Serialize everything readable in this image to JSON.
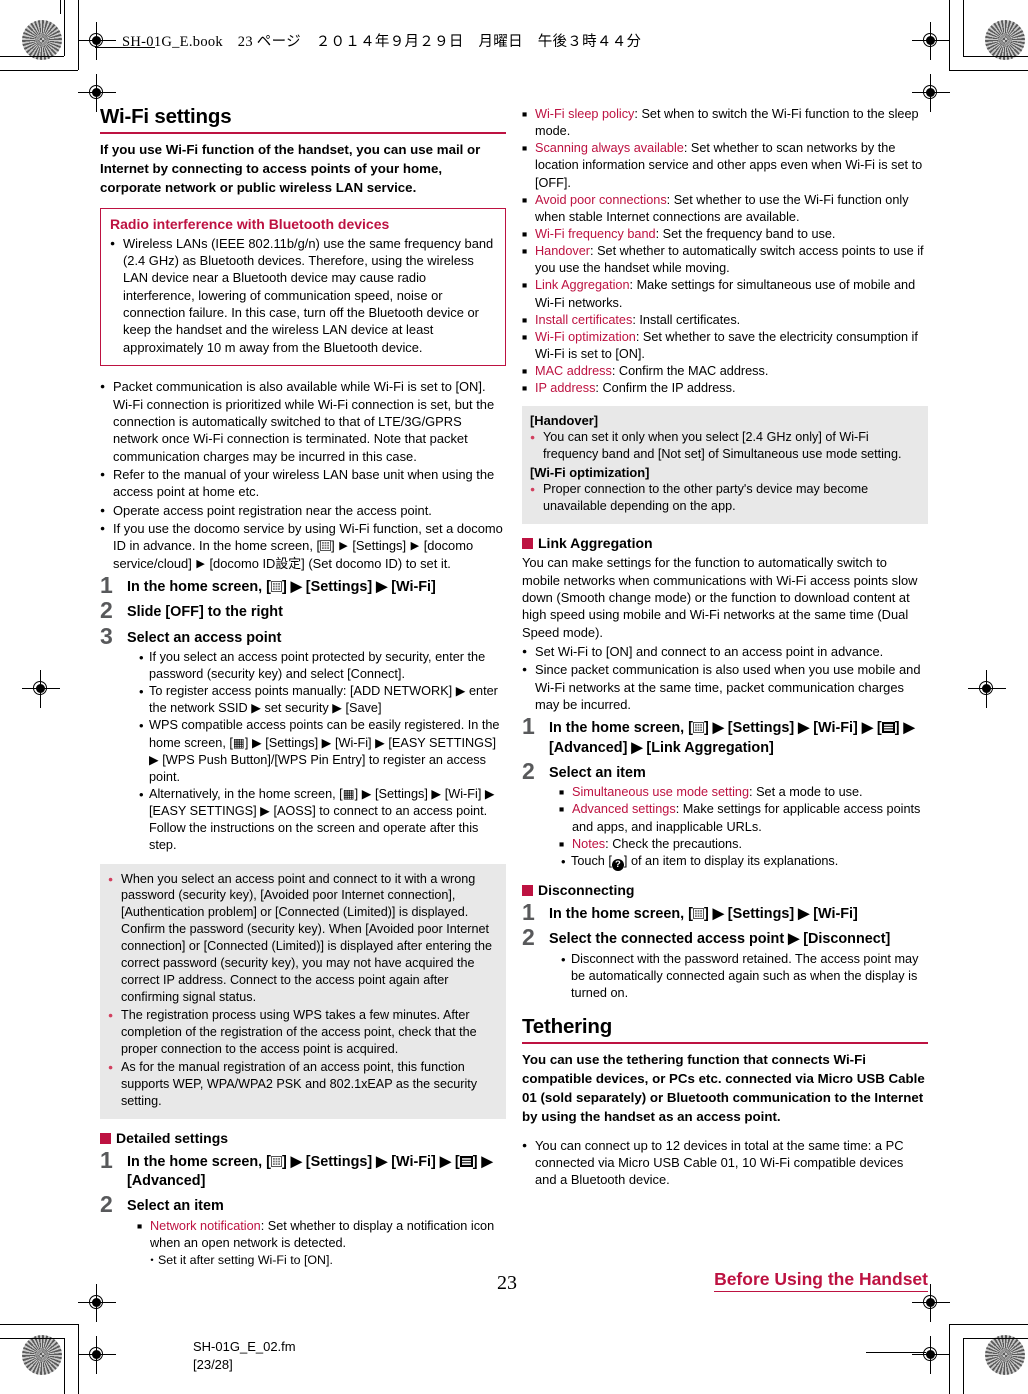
{
  "header": {
    "file_line": "SH-01G_E.book　23 ページ　２０１４年９月２９日　月曜日　午後３時４４分"
  },
  "footer": {
    "page_number": "23",
    "chapter": "Before Using the Handset",
    "file_name": "SH-01G_E_02.fm",
    "file_pages": "[23/28]"
  },
  "colors": {
    "accent": "#bd1241",
    "note_bg": "#e8e8e8",
    "step_num": "#58595b"
  },
  "left_column": {
    "section_title": "Wi-Fi settings",
    "lead": "If you use Wi-Fi function of the handset, you can use mail or Internet by connecting to access points of your home, corporate network or public wireless LAN service.",
    "red_box": {
      "title": "Radio interference with Bluetooth devices",
      "bullets": [
        "Wireless LANs (IEEE 802.11b/g/n) use the same frequency band (2.4 GHz) as Bluetooth devices. Therefore, using the wireless LAN device near a Bluetooth device may cause radio interference, lowering of communication speed, noise or connection failure. In this case, turn off the Bluetooth device or keep the handset and the wireless LAN device at least approximately 10 m away from the Bluetooth device."
      ]
    },
    "notes": [
      "Packet communication is also available while Wi-Fi is set to [ON]. Wi-Fi connection is prioritized while Wi-Fi connection is set, but the connection is automatically switched to that of LTE/3G/GPRS network once Wi-Fi connection is terminated. Note that packet communication charges may be incurred in this case.",
      "Refer to the manual of your wireless LAN base unit when using the access point at home etc.",
      "Operate access point registration near the access point."
    ],
    "note_docomo": {
      "part1": "If you use the docomo service by using Wi-Fi function, set a docomo ID in advance. In the home screen, [",
      "part2": "] ",
      "part3": " [Settings] ",
      "part4": " [docomo service/cloud] ",
      "part5": " [docomo ID設定] (Set docomo ID) to set it."
    },
    "steps": [
      {
        "num": "1",
        "title_pre": "In the home screen, [",
        "title_post": "] ▶ [Settings] ▶ [Wi-Fi]"
      },
      {
        "num": "2",
        "title": "Slide [OFF] to the right"
      },
      {
        "num": "3",
        "title": "Select an access point",
        "bullets": [
          "If you select an access point protected by security, enter the password (security key) and select [Connect].",
          "To register access points manually: [ADD NETWORK] ▶ enter the network SSID ▶ set security ▶ [Save]",
          "WPS compatible access points can be easily registered. In the home screen, [▦] ▶ [Settings] ▶ [Wi-Fi] ▶ [EASY SETTINGS] ▶ [WPS Push Button]/[WPS Pin Entry] to register an access point.",
          "Alternatively, in the home screen, [▦] ▶ [Settings] ▶ [Wi-Fi] ▶ [EASY SETTINGS] ▶ [AOSS] to connect to an access point. Follow the instructions on the screen and operate after this step."
        ]
      }
    ],
    "grey_notes": [
      "When you select an access point and connect to it with a wrong password (security key), [Avoided poor Internet connection], [Authentication problem] or [Connected (Limited)] is displayed. Confirm the password (security key). When [Avoided poor Internet connection] or [Connected (Limited)] is displayed after entering the correct password (security key), you may not have acquired the correct IP address. Connect to the access point again after confirming signal status.",
      "The registration process using WPS takes a few minutes. After completion of the registration of the access point, check that the proper connection to the access point is acquired.",
      "As for the manual registration of an access point, this function supports WEP, WPA/WPA2 PSK and 802.1xEAP as the security setting."
    ],
    "detailed_settings": {
      "heading": "Detailed settings",
      "step1_num": "1",
      "step1_pre": "In the home screen, [",
      "step1_mid": "] ▶ [Settings] ▶ [Wi-Fi] ▶ [",
      "step1_post": "] ▶ [Advanced]",
      "step2_num": "2",
      "step2_title": "Select an item",
      "items": [
        {
          "term": "Network notification",
          "desc": ": Set whether to display a notification icon when an open network is detected."
        }
      ],
      "subnote": "Set it after setting Wi-Fi to [ON]."
    }
  },
  "right_column": {
    "advanced_items": [
      {
        "term": "Wi-Fi sleep policy",
        "desc": ": Set when to switch the Wi-Fi function to the sleep mode."
      },
      {
        "term": "Scanning always available",
        "desc": ": Set whether to scan networks by the location information service and other apps even when Wi-Fi is set to [OFF]."
      },
      {
        "term": "Avoid poor connections",
        "desc": ": Set whether to use the Wi-Fi function only when stable Internet connections are available."
      },
      {
        "term": "Wi-Fi frequency band",
        "desc": ": Set the frequency band to use."
      },
      {
        "term": "Handover",
        "desc": ": Set whether to automatically switch access points to use if you use the handset while moving."
      },
      {
        "term": "Link Aggregation",
        "desc": ": Make settings for simultaneous use of mobile and Wi-Fi networks."
      },
      {
        "term": "Install certificates",
        "desc": ": Install certificates."
      },
      {
        "term": "Wi-Fi optimization",
        "desc": ": Set whether to save the electricity consumption if Wi-Fi is set to [ON]."
      },
      {
        "term": "MAC address",
        "desc": ": Confirm the MAC address."
      },
      {
        "term": "IP address",
        "desc": ": Confirm the IP address."
      }
    ],
    "grey_block": {
      "head1": "[Handover]",
      "note1": "You can set it only when you select [2.4 GHz only] of Wi-Fi frequency band and [Not set] of Simultaneous use mode setting.",
      "head2": "[Wi-Fi optimization]",
      "note2": "Proper connection to the other party's device may become unavailable depending on the app."
    },
    "link_aggregation": {
      "heading": "Link Aggregation",
      "body": "You can make settings for the function to automatically switch to mobile networks when communications with Wi-Fi access points slow down (Smooth change mode) or the function to download content at high speed using mobile and Wi-Fi networks at the same time (Dual Speed mode).",
      "bullets": [
        "Set Wi-Fi to [ON] and connect to an access point in advance.",
        "Since packet communication is also used when you use mobile and Wi-Fi networks at the same time, packet communication charges may be incurred."
      ],
      "step1_num": "1",
      "step1_pre": "In the home screen, [",
      "step1_mid": "] ▶ [Settings] ▶ [Wi-Fi] ▶ [",
      "step1_post": "] ▶ [Advanced] ▶ [Link Aggregation]",
      "step2_num": "2",
      "step2_title": "Select an item",
      "items": [
        {
          "term": "Simultaneous use mode setting",
          "desc": ": Set a mode to use."
        },
        {
          "term": "Advanced settings",
          "desc": ": Make settings for applicable access points and apps, and inapplicable URLs."
        },
        {
          "term": "Notes",
          "desc": ": Check the precautions."
        }
      ],
      "touch_note_pre": "Touch [",
      "touch_note_post": "] of an item to display its explanations."
    },
    "disconnecting": {
      "heading": "Disconnecting",
      "step1_num": "1",
      "step1_pre": "In the home screen, [",
      "step1_post": "] ▶ [Settings] ▶ [Wi-Fi]",
      "step2_num": "2",
      "step2_title": "Select the connected access point ▶ [Disconnect]",
      "bullets": [
        "Disconnect with the password retained. The access point may be automatically connected again such as when the display is turned on."
      ]
    },
    "tethering": {
      "section_title": "Tethering",
      "lead": "You can use the tethering function that connects Wi-Fi compatible devices, or PCs etc. connected via Micro USB Cable 01 (sold separately) or Bluetooth communication to the Internet by using the handset as an access point.",
      "bullets": [
        "You can connect up to 12 devices in total at the same time: a PC connected via Micro USB Cable 01, 10 Wi-Fi compatible devices and a Bluetooth device."
      ]
    }
  }
}
